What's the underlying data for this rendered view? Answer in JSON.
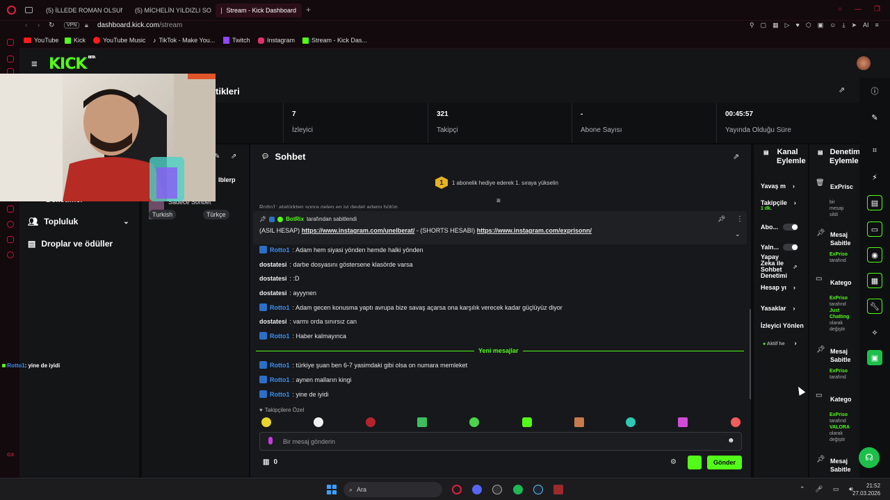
{
  "browser": {
    "tabs": [
      {
        "label": "(5) İLLEDE ROMAN OLSUN",
        "icon": "youtube-icon"
      },
      {
        "label": "(5) MİCHELİN YILDIZLI SO",
        "icon": "youtube-icon"
      },
      {
        "label": "Stream - Kick Dashboard",
        "icon": "kick-icon"
      }
    ],
    "url_domain": "dashboard.kick.com",
    "url_path": "/stream",
    "vpn": "VPN",
    "ai_label": "AI",
    "bookmarks": [
      "YouTube",
      "Kick",
      "YouTube Music",
      "TikTok - Make You...",
      "Twitch",
      "Instagram",
      "Stream - Kick Das..."
    ]
  },
  "kick": {
    "logo": "KICK",
    "logo_sup": "BETA",
    "nav": {
      "partial1": "Denetimci",
      "community": "Topluluk",
      "drops": "Droplar ve ödüller"
    },
    "section_title_partial": "tikleri",
    "stats": [
      {
        "value": "7",
        "label": "İzleyici"
      },
      {
        "value": "321",
        "label": "Takipçi"
      },
      {
        "value": "-",
        "label": "Abone Sayısı"
      },
      {
        "value": "00:45:57",
        "label": "Yayında Olduğu Süre"
      }
    ],
    "stream_info": {
      "title_partial": "Iblerp",
      "category": "Sadece Sohbet",
      "tags": [
        "Turkish",
        "Türkçe"
      ]
    },
    "chat": {
      "title": "Sohbet",
      "gift_banner": "1 abonelik hediye ederek 1. sıraya yükselin",
      "gift_rank": "1",
      "truncated_line": "Rotto1: atatürkten sonra gelen en iyi devlet adamı bütün",
      "pinned_by_user": "BotRix",
      "pinned_by_text": "tarafından sabitlendi",
      "pinned_prefix": "(ASIL HESAP)",
      "pinned_link1": "https://www.instagram.com/unelberat/",
      "pinned_mid": "- (SHORTS HESABI)",
      "pinned_link2": "https://www.instagram.com/exprisonn/",
      "messages": [
        {
          "user": "Rotto1",
          "text": ": Adam hem siyasi yönden hemde halki yönden"
        },
        {
          "user": "dostatesi",
          "text": ": darbe dosyasını göstersene klasörde varsa"
        },
        {
          "user": "dostatesi",
          "text": ": :D"
        },
        {
          "user": "dostatesi",
          "text": ": ayyynen"
        },
        {
          "user": "Rotto1",
          "text": ": Adam gecen konusma yaptı avrupa bize savaş açarsa ona karşılık verecek kadar güçlüyüz diyor"
        },
        {
          "user": "dostatesi",
          "text": ": varmı orda sınırsız can"
        },
        {
          "user": "Rotto1",
          "text": ": Haber kalmayınca"
        }
      ],
      "new_messages_label": "Yeni mesajlar",
      "new_messages": [
        {
          "user": "Rotto1",
          "text": ": türkiye şuan ben 6-7 yasimdaki gibi olsa on numara memleket"
        },
        {
          "user": "Rotto1",
          "text": ": aynen malların kingi"
        },
        {
          "user": "Rotto1",
          "text": ": yine de iyidi"
        }
      ],
      "followers_only": "Takipçilere Özel",
      "input_placeholder": "Bir mesaj gönderin",
      "points": "0",
      "send_label": "Gönder"
    },
    "channel_actions": {
      "title_line1": "Kanal",
      "title_line2": "Eylemle",
      "items": [
        "Yavaş m",
        "Takipçile",
        "1 dk.",
        "Abo...",
        "Yaln...",
        "Yapay",
        "Zeka ile",
        "Sohbet",
        "Denetimi",
        "Hesap yı",
        "Yasaklar",
        "İzleyici Yönlen",
        "Aktif he"
      ]
    },
    "mod_actions": {
      "title_line1": "Denetim",
      "title_line2": "Eylemle",
      "entries": [
        {
          "title": "ExPrisc",
          "sub": [
            "bir",
            "mesajı",
            "sildi"
          ]
        },
        {
          "title": "Mesaj",
          "title2": "Sabitle",
          "sub": [
            "ExPriso",
            "tarafınd"
          ]
        },
        {
          "title": "Katego",
          "sub": [
            "ExPriso",
            "tarafınd",
            "Just",
            "Chatting",
            "olarak",
            "değiştir"
          ]
        },
        {
          "title": "Mesaj",
          "title2": "Sabitle",
          "sub": [
            "ExPriso",
            "tarafınd"
          ]
        },
        {
          "title": "Katego",
          "sub": [
            "ExPriso",
            "tarafınd",
            "VALORA",
            "olarak",
            "değiştir"
          ]
        },
        {
          "title": "Mesaj",
          "title2": "Sabitle",
          "sub": []
        }
      ]
    },
    "overlay_chat": {
      "user": "Rotto1",
      "text": ": yine de iyidi"
    }
  },
  "taskbar": {
    "search": "Ara",
    "time": "21:52",
    "date": "27.03.2026"
  }
}
